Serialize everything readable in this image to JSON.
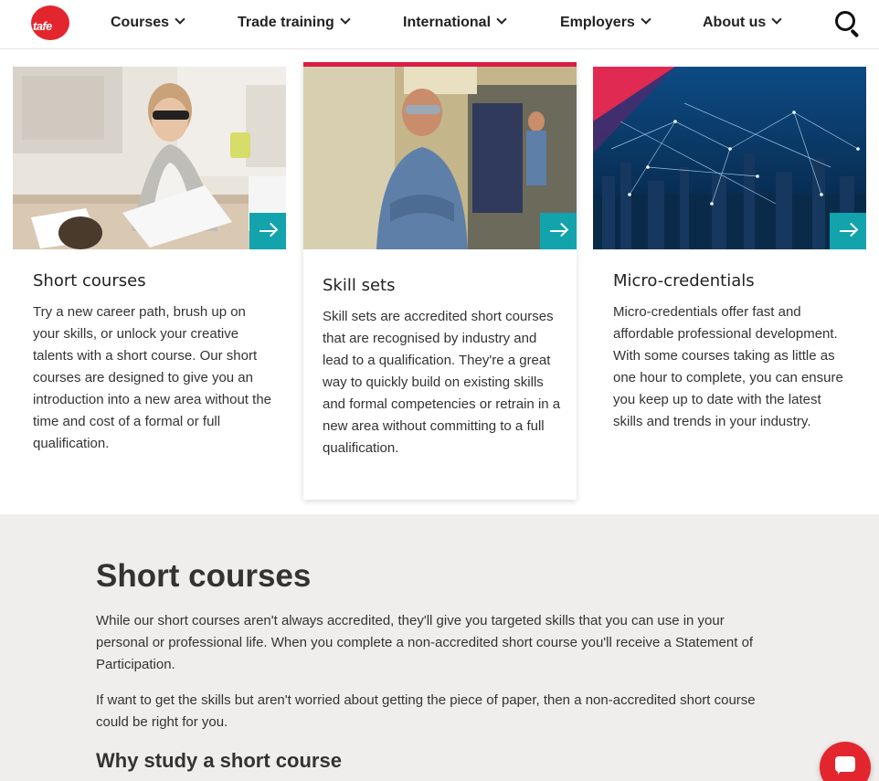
{
  "header": {
    "logo_text": "tafe",
    "nav": [
      {
        "label": "Courses"
      },
      {
        "label": "Trade training"
      },
      {
        "label": "International"
      },
      {
        "label": "Employers"
      },
      {
        "label": "About us"
      }
    ],
    "search_icon": "search-icon"
  },
  "cards": [
    {
      "title": "Short courses",
      "text": "Try a new career path, brush up on your skills, or unlock your creative talents with a short course. Our short courses are designed to give you an introduction into a new area without the time and cost of a formal or full qualification."
    },
    {
      "title": "Skill sets",
      "text": "Skill sets are accredited short courses that are recognised by industry and lead to a qualification. They're a great way to quickly build on existing skills and formal competencies or retrain in a new area without committing to a full qualification."
    },
    {
      "title": "Micro-credentials",
      "text": "Micro-credentials offer fast and affordable professional development. With some courses taking as little as one hour to complete, you can ensure you keep up to date with the latest skills and trends in your industry."
    }
  ],
  "section": {
    "title": "Short courses",
    "para1": "While our short courses aren't always accredited, they'll give you targeted skills that you can use in your personal or professional life. When you complete a non-accredited short course you'll receive a Statement of Participation.",
    "para2": "If want to get the skills but aren't worried about getting the piece of paper, then a non-accredited short course could be right for you.",
    "subheading": "Why study a short course"
  },
  "colors": {
    "brand_red": "#e3262d",
    "accent_teal": "#12a3ad",
    "featured_border": "#d91d45",
    "section_bg": "#f0eeec"
  }
}
